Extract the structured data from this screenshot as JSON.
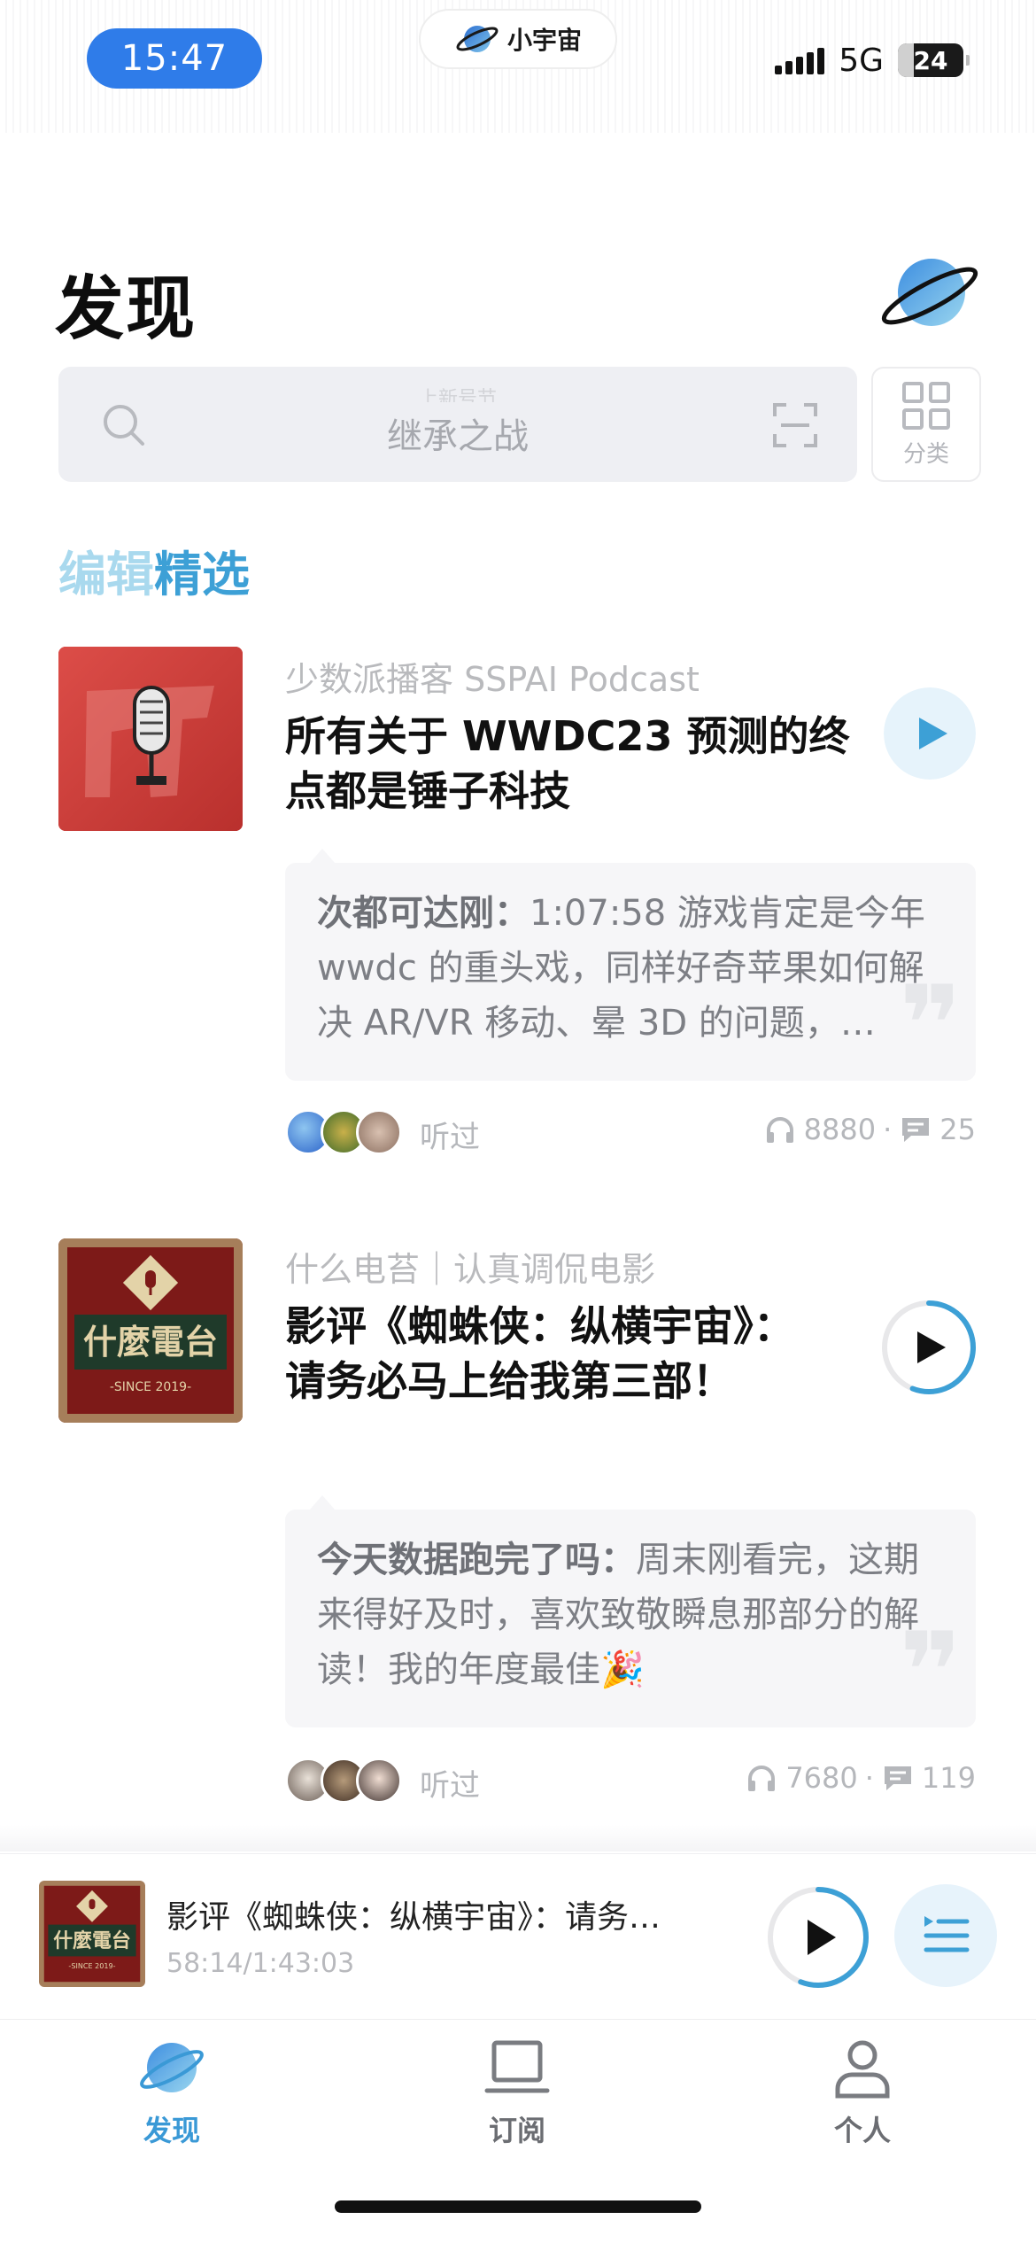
{
  "status_bar": {
    "time": "15:47",
    "app_badge": "小宇宙",
    "network": "5G",
    "battery": "24",
    "battery_level": 0.24
  },
  "header": {
    "title": "发现"
  },
  "search": {
    "ghost_text": "上新号节",
    "placeholder": "继承之战",
    "category_label": "分类"
  },
  "section": {
    "title_part1": "编辑",
    "title_part2": "精选"
  },
  "feed": [
    {
      "podcast": "少数派播客 SSPAI Podcast",
      "title": "所有关于 WWDC23 预测的终点都是锤子科技",
      "comment_user": "次都可达刚：",
      "comment_text": "1:07:58 游戏肯定是今年 wwdc 的重头戏，同样好奇苹果如何解决 AR/VR 移动、晕 3D 的问题，…",
      "listened_label": "听过",
      "plays": "8880",
      "comments": "25",
      "progress": 0
    },
    {
      "podcast": "什么电苔｜认真调侃电影",
      "title": "影评《蜘蛛侠：纵横宇宙》：请务必马上给我第三部！",
      "comment_user": "今天数据跑完了吗：",
      "comment_text": "周末刚看完，这期来得好及时，喜欢致敬瞬息那部分的解读！我的年度最佳🎉",
      "listened_label": "听过",
      "plays": "7680",
      "comments": "119",
      "progress": 0.56
    }
  ],
  "cover_text": {
    "station_name": "什麼電台",
    "since": "-SINCE 2019-"
  },
  "mini_player": {
    "title": "影评《蜘蛛侠：纵横宇宙》：请务…",
    "time": "58:14/1:43:03",
    "progress": 0.56
  },
  "tabs": [
    {
      "label": "发现",
      "icon": "planet-icon",
      "active": true
    },
    {
      "label": "订阅",
      "icon": "subscribe-icon",
      "active": false
    },
    {
      "label": "个人",
      "icon": "person-icon",
      "active": false
    }
  ],
  "colors": {
    "accent": "#3a99d6",
    "time_pill": "#2f7ce9",
    "sspai_red": "#d23d3a"
  }
}
